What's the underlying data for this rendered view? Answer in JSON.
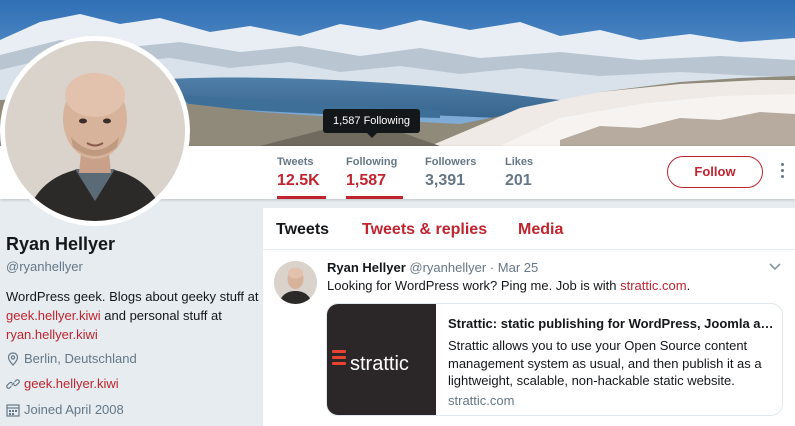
{
  "banner": {
    "image": "snowy-mountain-lake-landscape"
  },
  "tooltip": {
    "text": "1,587 Following"
  },
  "nav": {
    "stats": [
      {
        "label": "Tweets",
        "value": "12.5K",
        "active": true
      },
      {
        "label": "Following",
        "value": "1,587",
        "active": true
      },
      {
        "label": "Followers",
        "value": "3,391",
        "active": false
      },
      {
        "label": "Likes",
        "value": "201",
        "active": false
      }
    ],
    "follow_label": "Follow",
    "more_icon": "more-vertical-icon"
  },
  "profile": {
    "name": "Ryan Hellyer",
    "handle": "@ryanhellyer",
    "bio_text_1": "WordPress geek. Blogs about geeky stuff at ",
    "bio_link_1": "geek.hellyer.kiwi",
    "bio_text_2": " and personal stuff at ",
    "bio_link_2": "ryan.hellyer.kiwi",
    "location": "Berlin, Deutschland",
    "website": "geek.hellyer.kiwi",
    "joined": "Joined April 2008",
    "icons": {
      "location": "location-pin-icon",
      "website": "link-icon",
      "joined": "calendar-icon"
    }
  },
  "timeline": {
    "tabs": [
      {
        "label": "Tweets",
        "active": true
      },
      {
        "label": "Tweets & replies",
        "active": false
      },
      {
        "label": "Media",
        "active": false
      }
    ],
    "tweet": {
      "name": "Ryan Hellyer",
      "handle": "@ryanhellyer",
      "dot": "·",
      "date": "Mar 25",
      "text_prefix": "Looking for WordPress work? Ping me. Job is with ",
      "text_link": "strattic.com",
      "text_suffix": ".",
      "card": {
        "logo_text": "strattic",
        "title": "Strattic: static publishing for WordPress, Joomla and Drupal",
        "description": "Strattic allows you to use your Open Source content management system as usual, and then publish it as a lightweight, scalable, non-hackable static website.",
        "domain": "strattic.com"
      }
    }
  },
  "colors": {
    "accent": "#c0242f",
    "text": "#14171a",
    "secondary_text": "#657786",
    "background": "#e6ecf0"
  }
}
